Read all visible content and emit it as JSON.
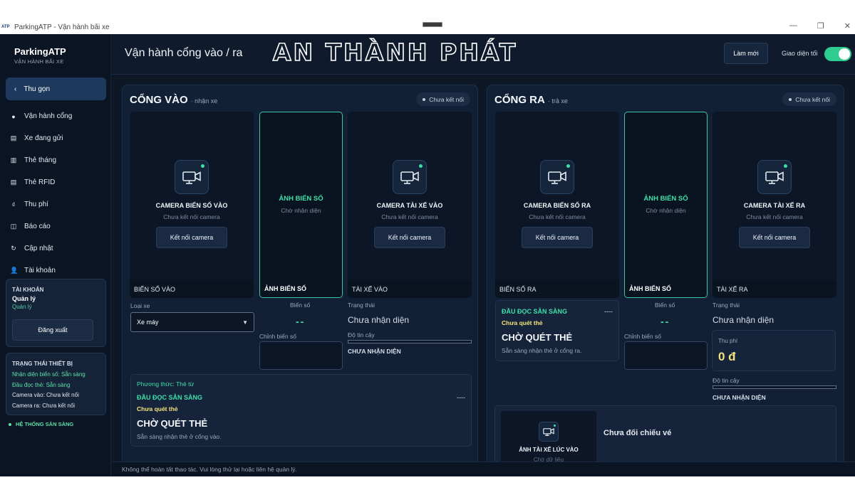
{
  "window": {
    "title": "ParkingATP - Vận hành bãi xe",
    "logo_text": "ATP",
    "min_glyph": "—",
    "max_glyph": "❐",
    "close_glyph": "✕"
  },
  "brand": {
    "name": "ParkingATP",
    "subtitle": "VẬN HÀNH BÃI XE"
  },
  "sidebar": {
    "collapse_label": "Thu gọn",
    "items": [
      {
        "icon": "gate-icon",
        "glyph": "●",
        "label": "Vận hành cổng"
      },
      {
        "icon": "vehicle-icon",
        "glyph": "▤",
        "label": "Xe đang gửi"
      },
      {
        "icon": "monthly-card-icon",
        "glyph": "▥",
        "label": "Thẻ tháng"
      },
      {
        "icon": "rfid-icon",
        "glyph": "▤",
        "label": "Thẻ RFID"
      },
      {
        "icon": "fee-icon",
        "glyph": "₫",
        "label": "Thu phí"
      },
      {
        "icon": "report-icon",
        "glyph": "◫",
        "label": "Báo cáo"
      },
      {
        "icon": "update-icon",
        "glyph": "↻",
        "label": "Cập nhật"
      },
      {
        "icon": "account-icon",
        "glyph": "👤",
        "label": "Tài khoản"
      }
    ],
    "account": {
      "title": "TÀI KHOẢN",
      "name": "Quản lý",
      "role": "Quản lý",
      "logout_label": "Đăng xuất"
    },
    "devices": {
      "title": "TRẠNG THÁI THIẾT BỊ",
      "lines": [
        "Nhận diện biển số: Sẵn sàng",
        "Đầu đọc thẻ: Sẵn sàng",
        "Camera vào: Chưa kết nối",
        "Camera ra: Chưa kết nối"
      ]
    },
    "system_status": "HỆ THỐNG SẴN SÀNG"
  },
  "header": {
    "title": "Vận hành cổng vào / ra",
    "watermark": "AN THÀNH PHÁT",
    "refresh_label": "Làm mới",
    "dark_mode_label": "Giao diện tối",
    "dark_mode_on": true
  },
  "gate_in": {
    "title": "CỔNG VÀO",
    "subtitle": "· nhận xe",
    "status": "Chưa kết nối",
    "cam_plate": {
      "name": "CAMERA BIỂN SỐ VÀO",
      "status": "Chưa kết nối camera",
      "button": "Kết nối camera",
      "footer": "BIỂN SỐ VÀO"
    },
    "plate_image": {
      "title": "ẢNH BIỂN SỐ",
      "status": "Chờ nhận diện",
      "footer": "ẢNH BIỂN SỐ"
    },
    "cam_driver": {
      "name": "CAMERA TÀI XẾ VÀO",
      "status": "Chưa kết nối camera",
      "button": "Kết nối camera",
      "footer": "TÀI XẾ VÀO"
    },
    "vehicle_type_label": "Loại xe",
    "vehicle_type_value": "Xe máy",
    "plate_label": "Biển số",
    "plate_value": "--",
    "edit_plate_label": "Chỉnh biển số",
    "state_label": "Trạng thái",
    "state_value": "Chưa nhận diện",
    "confidence_label": "Độ tin cậy",
    "confidence_value": "CHƯA NHẬN DIỆN",
    "reader": {
      "method": "Phương thức: Thẻ từ",
      "title": "ĐẦU ĐỌC SẴN SÀNG",
      "dash": "----",
      "warn": "Chưa quét thẻ",
      "big": "CHỜ QUÉT THẺ",
      "note": "Sẵn sàng nhận thẻ ở cổng vào."
    }
  },
  "gate_out": {
    "title": "CỔNG RA",
    "subtitle": "· trả xe",
    "status": "Chưa kết nối",
    "cam_plate": {
      "name": "CAMERA BIỂN SỐ RA",
      "status": "Chưa kết nối camera",
      "button": "Kết nối camera",
      "footer": "BIỂN SỐ RA"
    },
    "plate_image": {
      "title": "ẢNH BIỂN SỐ",
      "status": "Chờ nhận diện",
      "footer": "ẢNH BIỂN SỐ"
    },
    "cam_driver": {
      "name": "CAMERA TÀI XẾ RA",
      "status": "Chưa kết nối camera",
      "button": "Kết nối camera",
      "footer": "TÀI XẾ RA"
    },
    "reader": {
      "title": "ĐẦU ĐỌC SẴN SÀNG",
      "dash": "----",
      "warn": "Chưa quét thẻ",
      "big": "CHỜ QUÉT THẺ",
      "note": "Sẵn sàng nhận thẻ ở cổng ra."
    },
    "plate_label": "Biển số",
    "plate_value": "--",
    "edit_plate_label": "Chỉnh biển số",
    "state_label": "Trạng thái",
    "state_value": "Chưa nhận diện",
    "fee_label": "Thu phí",
    "fee_value": "0 đ",
    "confidence_label": "Độ tin cậy",
    "confidence_value": "CHƯA NHẬN DIỆN",
    "compare": {
      "thumb_label": "ẢNH TÀI XẾ LÚC VÀO",
      "thumb_status": "Chờ dữ liệu",
      "title": "Chưa đối chiếu vé"
    }
  },
  "statusbar": "Không thể hoàn tất thao tác. Vui lòng thử lại hoặc liên hệ quản lý.",
  "colors": {
    "accent": "#3fe0a8",
    "warning": "#f6e27a",
    "bg": "#0d1726",
    "panel": "#122035"
  }
}
